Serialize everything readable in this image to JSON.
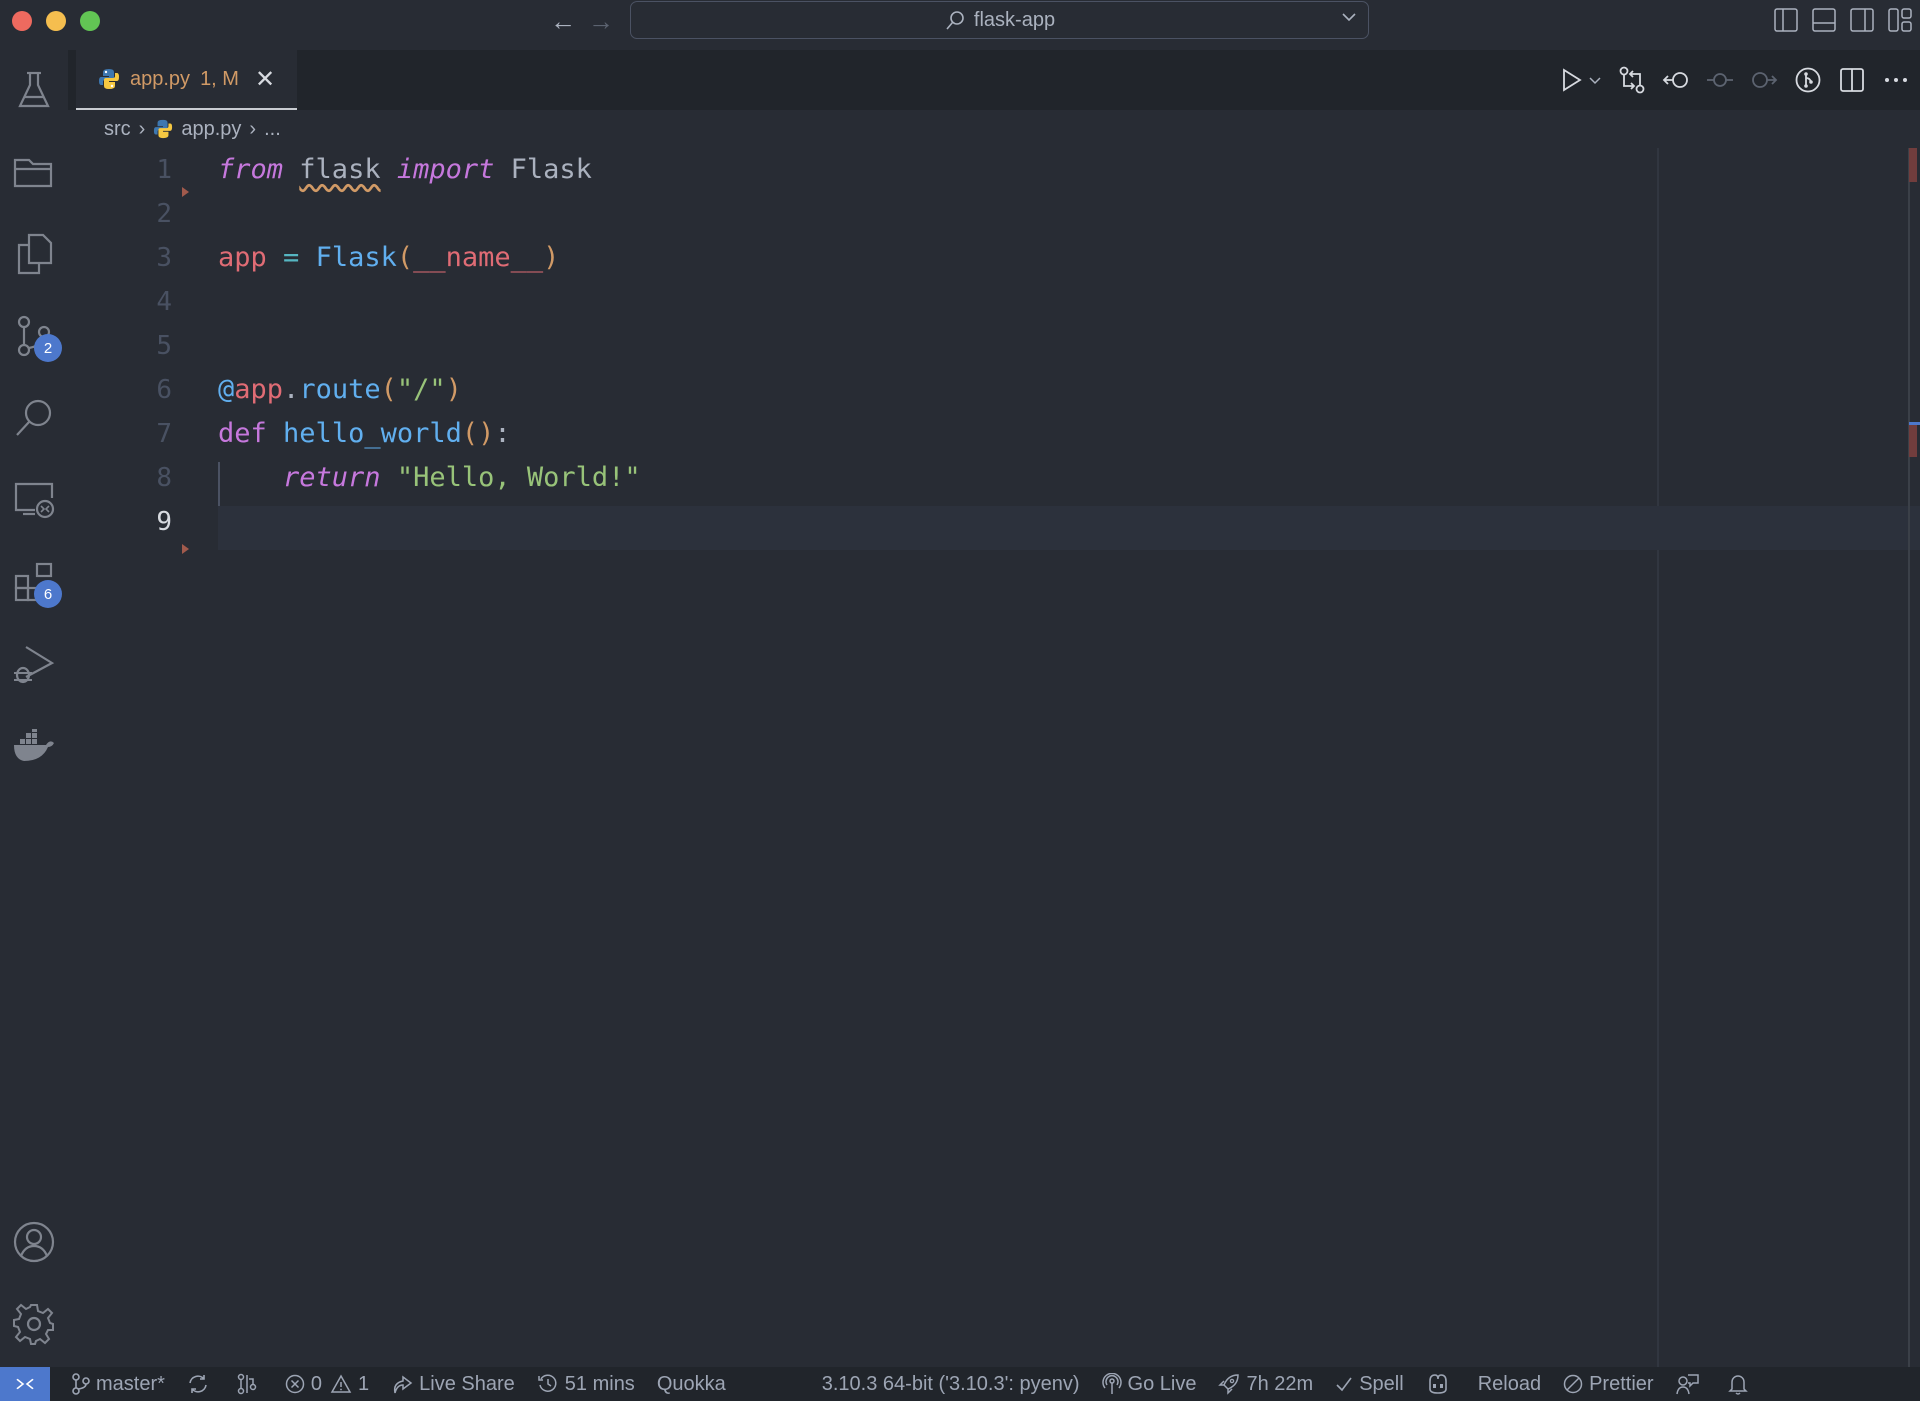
{
  "window": {
    "command_center_text": "flask-app"
  },
  "activity_bar": {
    "items": [
      {
        "name": "testing",
        "icon": "beaker-icon"
      },
      {
        "name": "explorer-folders",
        "icon": "folder-icon"
      },
      {
        "name": "explorer",
        "icon": "files-icon"
      },
      {
        "name": "source-control",
        "icon": "source-control-icon",
        "badge": "2"
      },
      {
        "name": "search",
        "icon": "search-icon"
      },
      {
        "name": "remote-explorer",
        "icon": "remote-explorer-icon"
      },
      {
        "name": "extensions",
        "icon": "extensions-icon",
        "badge": "6"
      },
      {
        "name": "run-and-debug",
        "icon": "debug-icon"
      },
      {
        "name": "docker",
        "icon": "docker-icon"
      }
    ],
    "bottom": [
      {
        "name": "accounts",
        "icon": "account-icon"
      },
      {
        "name": "manage",
        "icon": "gear-icon"
      }
    ]
  },
  "tabs": [
    {
      "label": "app.py",
      "status": "1, M",
      "active": true
    }
  ],
  "breadcrumb": [
    "src",
    "app.py",
    "..."
  ],
  "editor": {
    "active_line": 9,
    "lines": [
      {
        "n": "1",
        "tokens": [
          [
            "kw-i",
            "from"
          ],
          [
            "plain",
            " "
          ],
          [
            "plain squiggle",
            "flask"
          ],
          [
            "plain",
            " "
          ],
          [
            "kw-i",
            "import"
          ],
          [
            "plain",
            " Flask"
          ]
        ]
      },
      {
        "n": "2",
        "tokens": []
      },
      {
        "n": "3",
        "tokens": [
          [
            "var",
            "app"
          ],
          [
            "plain",
            " "
          ],
          [
            "op",
            "="
          ],
          [
            "plain",
            " "
          ],
          [
            "fn",
            "Flask"
          ],
          [
            "paren",
            "("
          ],
          [
            "var",
            "__name__"
          ],
          [
            "paren",
            ")"
          ]
        ]
      },
      {
        "n": "4",
        "tokens": []
      },
      {
        "n": "5",
        "tokens": []
      },
      {
        "n": "6",
        "tokens": [
          [
            "fn",
            "@"
          ],
          [
            "var",
            "app"
          ],
          [
            "plain",
            "."
          ],
          [
            "fn",
            "route"
          ],
          [
            "paren",
            "("
          ],
          [
            "str",
            "\"/\""
          ],
          [
            "paren",
            ")"
          ]
        ]
      },
      {
        "n": "7",
        "tokens": [
          [
            "kw",
            "def"
          ],
          [
            "plain",
            " "
          ],
          [
            "fn",
            "hello_world"
          ],
          [
            "paren",
            "()"
          ],
          [
            "plain",
            ":"
          ]
        ]
      },
      {
        "n": "8",
        "tokens": [
          [
            "plain",
            "    "
          ],
          [
            "kw-i",
            "return"
          ],
          [
            "plain",
            " "
          ],
          [
            "str",
            "\"Hello, World!\""
          ]
        ]
      },
      {
        "n": "9",
        "tokens": []
      }
    ]
  },
  "status_bar": {
    "branch": "master*",
    "errors": "0",
    "warnings": "1",
    "live_share": "Live Share",
    "time_tracker": "51 mins",
    "quokka": "Quokka",
    "python_interpreter": "3.10.3 64-bit ('3.10.3': pyenv)",
    "go_live": "Go Live",
    "session_time": "7h 22m",
    "spell": "Spell",
    "reload": "Reload",
    "prettier": "Prettier"
  },
  "colors": {
    "accent": "#4d78cc",
    "tab_modified": "#d19a66"
  }
}
